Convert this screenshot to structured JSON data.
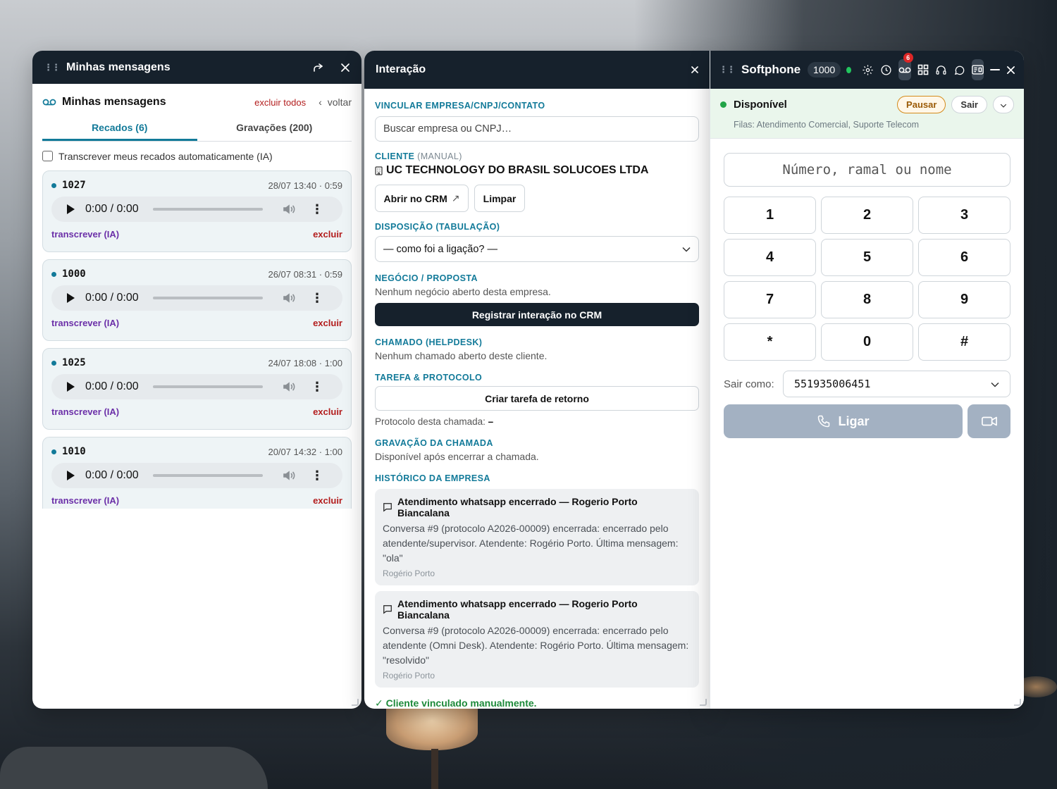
{
  "left": {
    "title": "Minhas mensagens",
    "subtitle": "Minhas mensagens",
    "delete_all": "excluir todos",
    "back": "voltar",
    "tabs": [
      {
        "label": "Recados (6)"
      },
      {
        "label": "Gravações (200)"
      }
    ],
    "auto_transcribe": "Transcrever meus recados automaticamente (IA)",
    "player_time": "0:00 / 0:00",
    "transcribe_label": "transcrever (IA)",
    "delete_label": "excluir",
    "messages": [
      {
        "ext": "1027",
        "datetime": "28/07 13:40 · 0:59"
      },
      {
        "ext": "1000",
        "datetime": "26/07 08:31 · 0:59"
      },
      {
        "ext": "1025",
        "datetime": "24/07 18:08 · 1:00"
      },
      {
        "ext": "1010",
        "datetime": "20/07 14:32 · 1:00"
      }
    ]
  },
  "middle": {
    "title": "Interação",
    "link_label": "VINCULAR EMPRESA/CNPJ/CONTATO",
    "search_placeholder": "Buscar empresa ou CNPJ…",
    "client_label": "CLIENTE",
    "client_mode": "(MANUAL)",
    "client_name": "UC TECHNOLOGY DO BRASIL SOLUCOES LTDA",
    "open_crm": "Abrir no CRM",
    "clear": "Limpar",
    "disposition_label": "DISPOSIÇÃO (TABULAÇÃO)",
    "disposition_value": "— como foi a ligação? —",
    "deal_label": "NEGÓCIO / PROPOSTA",
    "deal_text": "Nenhum negócio aberto desta empresa.",
    "register_btn": "Registrar interação no CRM",
    "ticket_label": "CHAMADO (HELPDESK)",
    "ticket_text": "Nenhum chamado aberto deste cliente.",
    "task_label": "TAREFA & PROTOCOLO",
    "task_btn": "Criar tarefa de retorno",
    "protocol_text": "Protocolo desta chamada:",
    "protocol_value": "–",
    "recording_label": "GRAVAÇÃO DA CHAMADA",
    "recording_text": "Disponível após encerrar a chamada.",
    "history_label": "HISTÓRICO DA EMPRESA",
    "history": [
      {
        "title": "Atendimento whatsapp encerrado — Rogerio Porto Biancalana",
        "body": "Conversa #9 (protocolo A2026-00009) encerrada: encerrado pelo atendente/supervisor. Atendente: Rogério Porto. Última mensagem: \"ola\"",
        "author": "Rogério Porto"
      },
      {
        "title": "Atendimento whatsapp encerrado — Rogerio Porto Biancalana",
        "body": "Conversa #9 (protocolo A2026-00009) encerrada: encerrado pelo atendente (Omni Desk). Atendente: Rogério Porto. Última mensagem: \"resolvido\"",
        "author": "Rogério Porto"
      }
    ],
    "linked_msg": "✓ Cliente vinculado manualmente."
  },
  "right": {
    "title": "Softphone",
    "extension": "1000",
    "voicemail_count": "6",
    "status": "Disponível",
    "pause": "Pausar",
    "exit": "Sair",
    "queues": "Filas: Atendimento Comercial, Suporte Telecom",
    "dial_placeholder": "Número, ramal ou nome",
    "keys": [
      "1",
      "2",
      "3",
      "4",
      "5",
      "6",
      "7",
      "8",
      "9",
      "*",
      "0",
      "#"
    ],
    "caller_id_label": "Sair como:",
    "caller_id_value": "551935006451",
    "call_btn": "Ligar"
  },
  "colors": {
    "header": "#16212c",
    "accent": "#127a99",
    "danger": "#b31d1d",
    "ai": "#6b2fa8",
    "ok": "#1d8a3a",
    "call": "#a3b1c2"
  }
}
